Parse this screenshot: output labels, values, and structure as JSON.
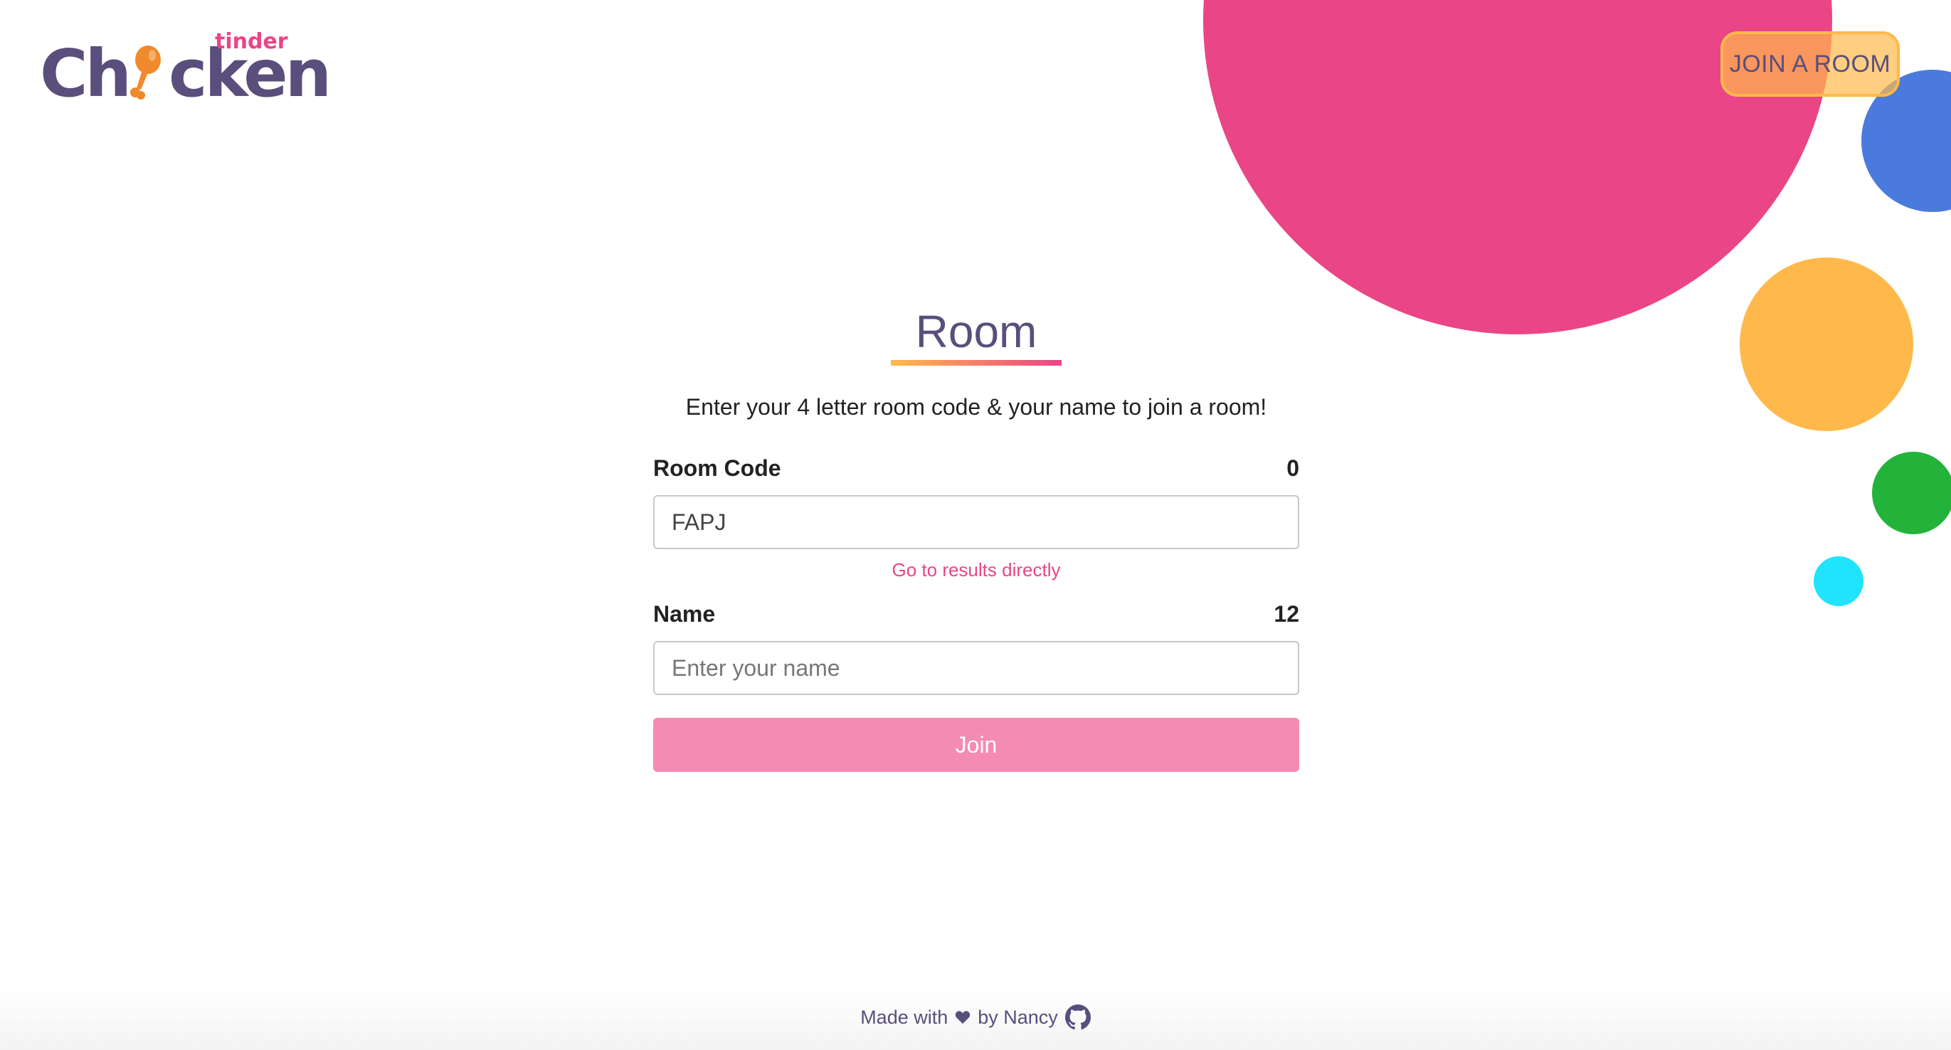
{
  "header": {
    "logo": {
      "main": "Chicken",
      "sub": "tinder",
      "leg_icon": "chicken-leg-icon"
    },
    "join_room_label": "JOIN A ROOM"
  },
  "main": {
    "title": "Room",
    "subtitle": "Enter your 4 letter room code & your name to join a room!",
    "room_code": {
      "label": "Room Code",
      "count": "0",
      "value": "FAPJ"
    },
    "results_link": "Go to results directly",
    "name": {
      "label": "Name",
      "count": "12",
      "placeholder": "Enter your name",
      "value": ""
    },
    "join_label": "Join"
  },
  "footer": {
    "made_with": "Made with",
    "heart_icon": "heart-icon",
    "by": "by Nancy",
    "github_icon": "github-icon"
  },
  "colors": {
    "brand_purple": "#5a4e7c",
    "brand_pink": "#ea4586",
    "brand_orange": "#ffb94b",
    "button_pink": "#f48bb3",
    "bubble_blue": "#4a7bdc",
    "bubble_green": "#23b33a",
    "bubble_cyan": "#1fe4fb"
  }
}
